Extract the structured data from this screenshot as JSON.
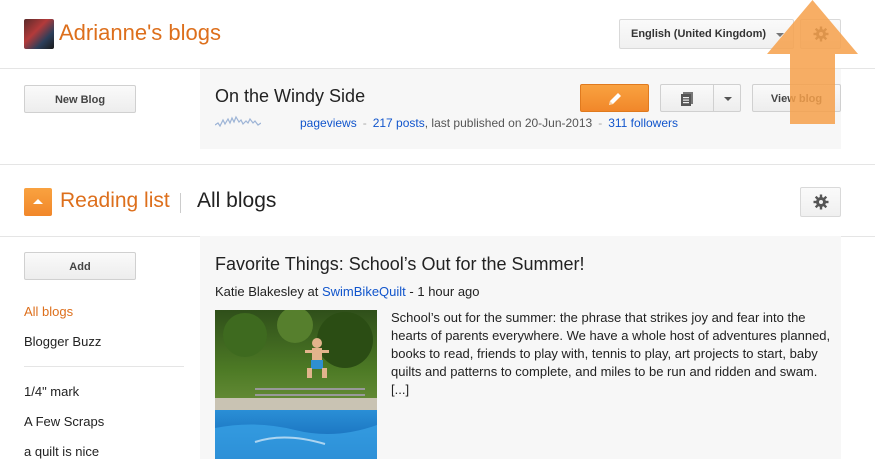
{
  "header": {
    "title": "Adrianne's blogs",
    "language": "English (United Kingdom)"
  },
  "blogs": {
    "new_blog_label": "New Blog",
    "blog": {
      "name": "On the Windy Side",
      "pageviews_label": "pageviews",
      "posts": "217 posts",
      "last_published": "last published on 20-Jun-2013",
      "followers": "311 followers",
      "view_blog_label": "View blog"
    }
  },
  "reading_list": {
    "title": "Reading list",
    "current_view": "All blogs",
    "add_label": "Add",
    "sidebar_items": [
      {
        "label": "All blogs",
        "active": true
      },
      {
        "label": "Blogger Buzz",
        "active": false
      },
      {
        "label": "1/4\" mark",
        "active": false
      },
      {
        "label": "A Few Scraps",
        "active": false
      },
      {
        "label": "a quilt is nice",
        "active": false
      }
    ]
  },
  "post": {
    "title": "Favorite Things: School’s Out for the Summer!",
    "author": "Katie Blakesley",
    "at": "at",
    "blog": "SwimBikeQuilt",
    "time": "- 1 hour ago",
    "excerpt": "School’s out for the summer: the phrase that strikes joy and fear into the hearts of parents everywhere. We have a whole host of adventures planned, books to read, friends to play with, tennis to play, art projects to start, baby quilts and patterns to complete, and miles to be run and ridden and swam. [...]"
  },
  "icons": {
    "settings": "gear-icon",
    "edit": "pencil-icon",
    "posts": "document-list-icon",
    "collapse": "triangle-up-icon"
  },
  "colors": {
    "accent": "#dd6f1c",
    "button_orange": "#f1872a",
    "link": "#1155cc",
    "card_bg": "#f7f7f7"
  }
}
